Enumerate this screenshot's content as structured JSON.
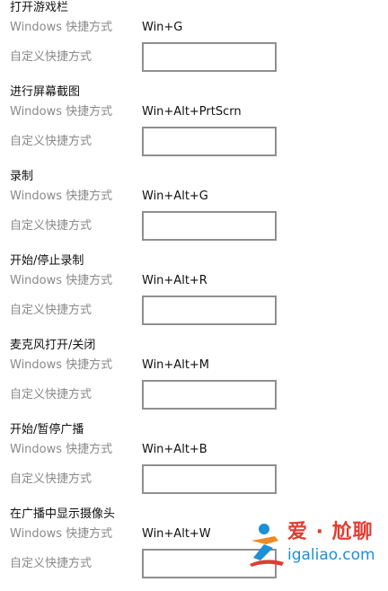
{
  "labels": {
    "windows_shortcut": "Windows 快捷方式",
    "custom_shortcut": "自定义快捷方式"
  },
  "sections": [
    {
      "title": "打开游戏栏",
      "shortcut": "Win+G"
    },
    {
      "title": "进行屏幕截图",
      "shortcut": "Win+Alt+PrtScrn"
    },
    {
      "title": "录制",
      "shortcut": "Win+Alt+G"
    },
    {
      "title": "开始/停止录制",
      "shortcut": "Win+Alt+R"
    },
    {
      "title": "麦克风打开/关闭",
      "shortcut": "Win+Alt+M"
    },
    {
      "title": "开始/暂停广播",
      "shortcut": "Win+Alt+B"
    },
    {
      "title": "在广播中显示摄像头",
      "shortcut": "Win+Alt+W"
    }
  ],
  "watermark": {
    "line1": "爱 · 尬聊",
    "line2": "igaliao.com"
  },
  "colors": {
    "title_text": "#111111",
    "label_text": "#8a8a8a",
    "input_border": "#8f8f8f",
    "watermark_red": "#e23c32",
    "watermark_blue": "#1d8fd6"
  }
}
